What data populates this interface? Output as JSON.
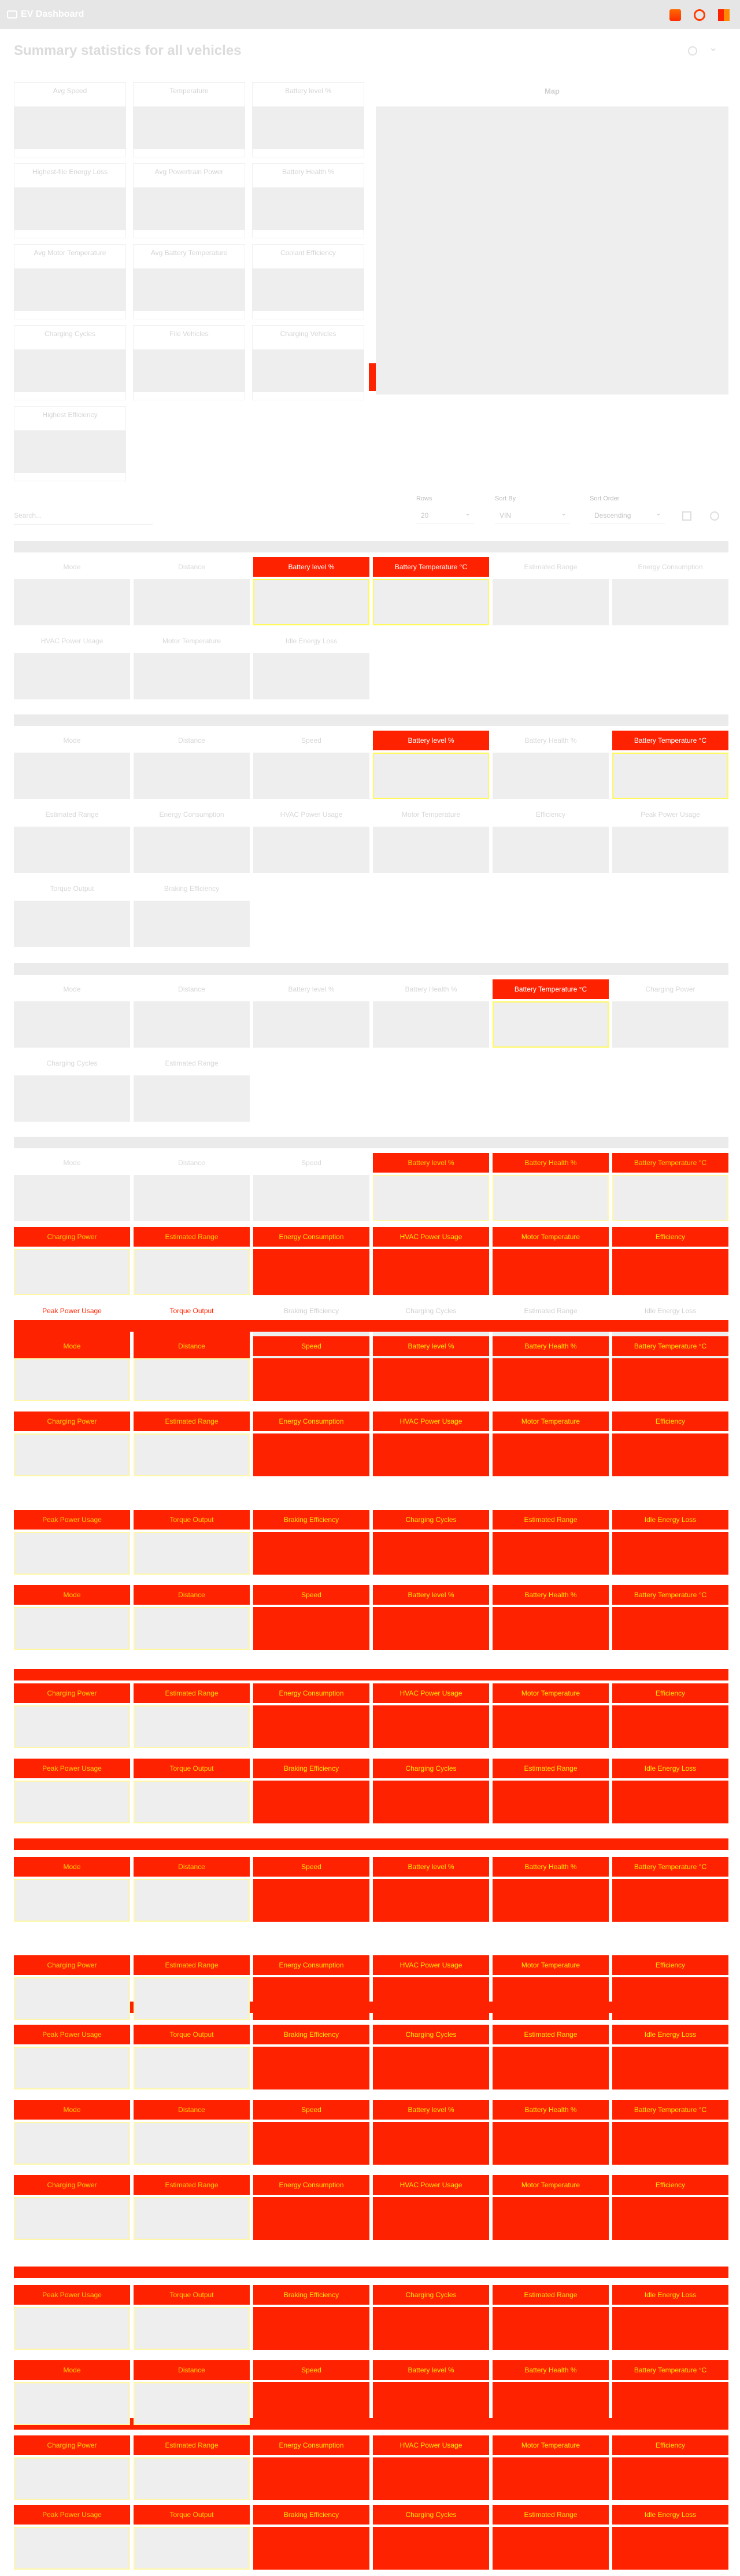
{
  "app": {
    "title": "EV Dashboard"
  },
  "header": {
    "title": "Summary statistics for all vehicles"
  },
  "summary": {
    "stats": [
      "Avg Speed",
      "Temperature",
      "Battery level %",
      "Highest-file Energy Loss",
      "Avg Powertrain Power",
      "Battery Health %",
      "Avg Motor Temperature",
      "Avg Battery Temperature",
      "Coolant Efficiency",
      "Charging Cycles",
      "File Vehicles",
      "Charging Vehicles",
      "Highest Efficiency"
    ],
    "map_title": "Map"
  },
  "filters": {
    "search_placeholder": "Search...",
    "rows_label": "Rows",
    "rows_value": "20",
    "sort_by_label": "Sort By",
    "sort_by_value": "VIN",
    "sort_order_label": "Sort Order",
    "sort_order_value": "Descending"
  },
  "cards": [
    {
      "fields": [
        "Mode",
        "Distance",
        "Battery level %",
        "Battery Temperature °C",
        "Estimated Range",
        "Energy Consumption",
        "HVAC Power Usage",
        "Motor Temperature",
        "Idle Energy Loss"
      ]
    },
    {
      "fields": [
        "Mode",
        "Distance",
        "Speed",
        "Battery level %",
        "Battery Health %",
        "Battery Temperature °C",
        "Estimated Range",
        "Energy Consumption",
        "HVAC Power Usage",
        "Motor Temperature",
        "Efficiency",
        "Peak Power Usage",
        "Torque Output",
        "Braking Efficiency"
      ]
    },
    {
      "fields": [
        "Mode",
        "Distance",
        "Battery level %",
        "Battery Health %",
        "Battery Temperature °C",
        "Charging Power",
        "Charging Cycles",
        "Estimated Range"
      ]
    },
    {
      "fields": [
        "Mode",
        "Distance",
        "Speed",
        "Battery level %",
        "Battery Health %",
        "Battery Temperature °C",
        "Charging Power",
        "Estimated Range",
        "Energy Consumption",
        "HVAC Power Usage",
        "Motor Temperature",
        "Efficiency",
        "Peak Power Usage",
        "Torque Output",
        "Braking Efficiency",
        "Charging Cycles",
        "Estimated Range",
        "Idle Energy Loss"
      ]
    }
  ]
}
